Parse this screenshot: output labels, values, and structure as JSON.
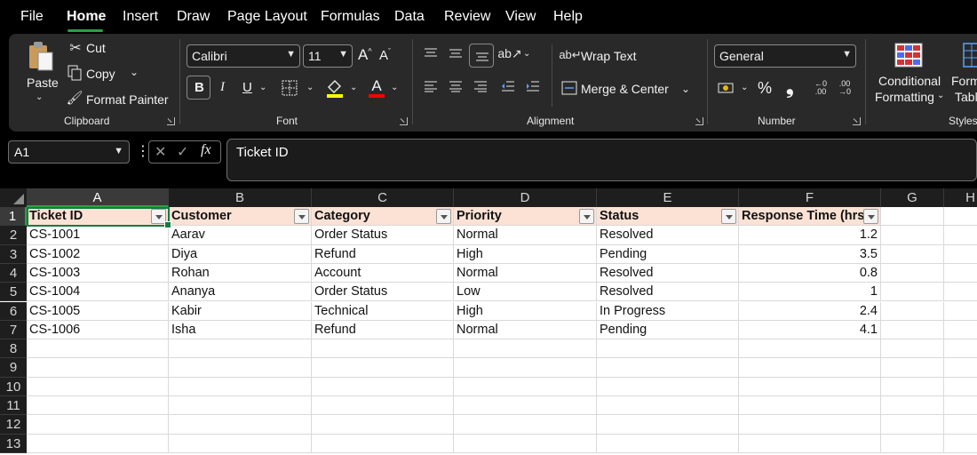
{
  "menu": {
    "file": "File",
    "home": "Home",
    "insert": "Insert",
    "draw": "Draw",
    "page_layout": "Page Layout",
    "formulas": "Formulas",
    "data": "Data",
    "review": "Review",
    "view": "View",
    "help": "Help"
  },
  "ribbon": {
    "clipboard": {
      "label": "Clipboard",
      "paste": "Paste",
      "cut": "Cut",
      "copy": "Copy",
      "format_painter": "Format Painter"
    },
    "font": {
      "label": "Font",
      "font_name": "Calibri",
      "font_size": "11",
      "bold": "B",
      "italic": "I",
      "underline": "U",
      "font_color_letter": "A"
    },
    "alignment": {
      "label": "Alignment",
      "wrap_text": "Wrap Text",
      "merge_center": "Merge & Center"
    },
    "number": {
      "label": "Number",
      "format": "General",
      "percent": "%",
      "comma": "❟"
    },
    "styles": {
      "label": "Styles",
      "conditional_line1": "Conditional",
      "conditional_line2": "Formatting",
      "format_table_line1": "Form",
      "format_table_line2": "Tabl"
    }
  },
  "formula_bar": {
    "name_box": "A1",
    "fx": "fx",
    "content": "Ticket ID"
  },
  "grid": {
    "columns": [
      "A",
      "B",
      "C",
      "D",
      "E",
      "F",
      "G",
      "H"
    ],
    "rows": [
      "1",
      "2",
      "3",
      "4",
      "5",
      "6",
      "7",
      "8",
      "9",
      "10",
      "11",
      "12",
      "13"
    ],
    "header": [
      "Ticket ID",
      "Customer",
      "Category",
      "Priority",
      "Status",
      "Response Time (hrs)"
    ],
    "data": [
      [
        "CS-1001",
        "Aarav",
        "Order Status",
        "Normal",
        "Resolved",
        "1.2"
      ],
      [
        "CS-1002",
        "Diya",
        "Refund",
        "High",
        "Pending",
        "3.5"
      ],
      [
        "CS-1003",
        "Rohan",
        "Account",
        "Normal",
        "Resolved",
        "0.8"
      ],
      [
        "CS-1004",
        "Ananya",
        "Order Status",
        "Low",
        "Resolved",
        "1"
      ],
      [
        "CS-1005",
        "Kabir",
        "Technical",
        "High",
        "In Progress",
        "2.4"
      ],
      [
        "CS-1006",
        "Isha",
        "Refund",
        "Normal",
        "Pending",
        "4.1"
      ]
    ]
  },
  "colors": {
    "accent": "#107c41",
    "header_fill": "#fbe2d5",
    "highlight_yellow": "#ffff00",
    "font_red": "#ff0000"
  }
}
